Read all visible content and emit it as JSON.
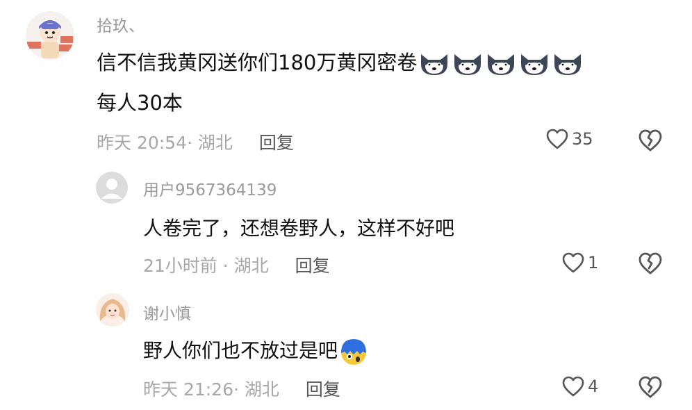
{
  "comments": [
    {
      "username": "拾玖、",
      "text_line1": "信不信我黄冈送你们180万黄冈密卷",
      "text_line2": "每人30本",
      "emojis": [
        "husky-emoji",
        "husky-emoji",
        "husky-emoji",
        "husky-emoji",
        "husky-emoji"
      ],
      "time_location": "昨天 20:54· 湖北",
      "reply_label": "回复",
      "likes": "35"
    }
  ],
  "replies": [
    {
      "username": "用户9567364139",
      "text": "人卷完了，还想卷野人，这样不好吧",
      "time_location": "21小时前 · 湖北",
      "reply_label": "回复",
      "likes": "1"
    },
    {
      "username": "谢小慎",
      "text": "野人你们也不放过是吧",
      "emoji": "shocked-blue-hair-emoji",
      "time_location": "昨天 21:26· 湖北",
      "reply_label": "回复",
      "likes": "4"
    }
  ],
  "icons": {
    "like": "heart-outline-icon",
    "dislike": "broken-heart-icon"
  },
  "colors": {
    "username": "#9a9a9a",
    "meta": "#a7a7a7",
    "text": "#111111",
    "icon": "#555555"
  }
}
